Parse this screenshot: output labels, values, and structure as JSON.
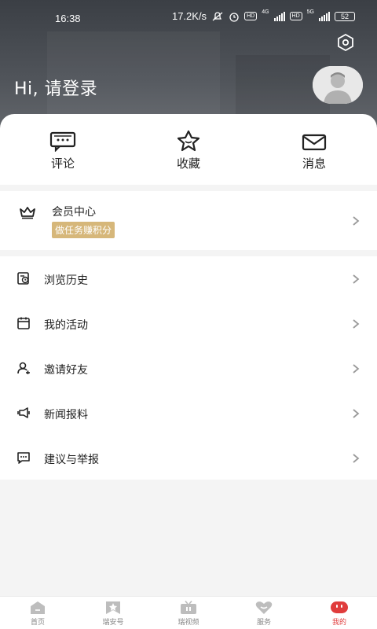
{
  "status_bar": {
    "time": "16:38",
    "speed": "17.2K/s",
    "hd1": "HD",
    "net1": "4G",
    "hd2": "HD",
    "net2": "5G",
    "battery": "52"
  },
  "header": {
    "greeting": "Hi, 请登录"
  },
  "quick_actions": [
    {
      "label": "评论",
      "icon": "comment-icon"
    },
    {
      "label": "收藏",
      "icon": "star-icon"
    },
    {
      "label": "消息",
      "icon": "mail-icon"
    }
  ],
  "member": {
    "title": "会员中心",
    "tag": "做任务赚积分",
    "icon": "crown-icon"
  },
  "menu": [
    {
      "label": "浏览历史",
      "icon": "history-icon"
    },
    {
      "label": "我的活动",
      "icon": "calendar-icon"
    },
    {
      "label": "邀请好友",
      "icon": "invite-user-icon"
    },
    {
      "label": "新闻报料",
      "icon": "news-tip-icon"
    },
    {
      "label": "建议与举报",
      "icon": "feedback-icon"
    }
  ],
  "tabbar": [
    {
      "label": "首页",
      "icon": "home-icon",
      "active": false
    },
    {
      "label": "瑞安号",
      "icon": "bookmark-icon",
      "active": false
    },
    {
      "label": "瑞视频",
      "icon": "tv-icon",
      "active": false
    },
    {
      "label": "服务",
      "icon": "heart-icon",
      "active": false
    },
    {
      "label": "我的",
      "icon": "profile-icon",
      "active": true
    }
  ],
  "colors": {
    "accent": "#e03c3c",
    "member_tag": "#d6b77a",
    "header_dark": "#3b3f45"
  }
}
